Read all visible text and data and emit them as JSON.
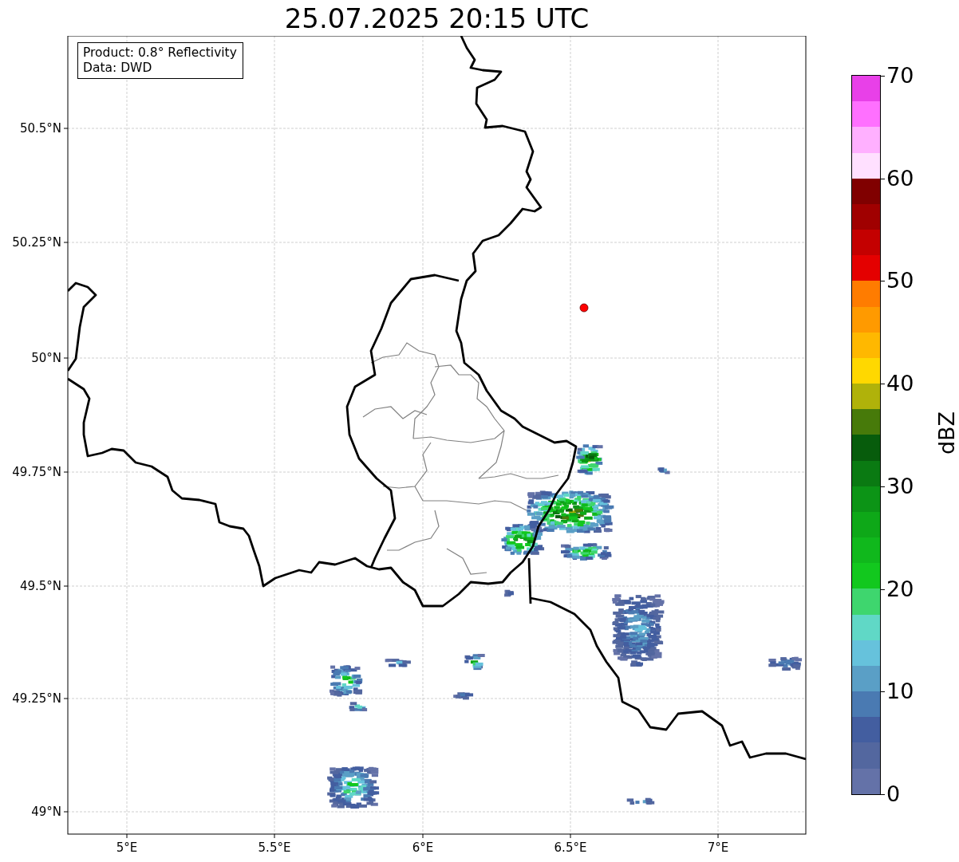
{
  "title": "25.07.2025 20:15 UTC",
  "info_box": {
    "lines": [
      "Product: 0.8° Reflectivity",
      "Data: DWD"
    ]
  },
  "map": {
    "x_ticks": [
      "5°E",
      "5.5°E",
      "6°E",
      "6.5°E",
      "7°E"
    ],
    "y_ticks": [
      "50.5°N",
      "50.25°N",
      "50°N",
      "49.75°N",
      "49.5°N",
      "49.25°N",
      "49°N"
    ]
  },
  "colorbar": {
    "label": "dBZ",
    "ticks": [
      "70",
      "60",
      "50",
      "40",
      "30",
      "20",
      "10",
      "0"
    ],
    "bins": [
      {
        "color": "#e840e8"
      },
      {
        "color": "#ff70ff"
      },
      {
        "color": "#ffb0ff"
      },
      {
        "color": "#ffe0ff"
      },
      {
        "color": "#800000"
      },
      {
        "color": "#a00000"
      },
      {
        "color": "#c40000"
      },
      {
        "color": "#e40000"
      },
      {
        "color": "#ff7c00"
      },
      {
        "color": "#ff9a00"
      },
      {
        "color": "#ffb800"
      },
      {
        "color": "#ffd800"
      },
      {
        "color": "#b0b20a"
      },
      {
        "color": "#477a0a"
      },
      {
        "color": "#075c0c"
      },
      {
        "color": "#0a7a12"
      },
      {
        "color": "#0c9416"
      },
      {
        "color": "#0ea818"
      },
      {
        "color": "#10b81c"
      },
      {
        "color": "#12c81e"
      },
      {
        "color": "#3ed66e"
      },
      {
        "color": "#60d8c6"
      },
      {
        "color": "#66c2dc"
      },
      {
        "color": "#5a9fc6"
      },
      {
        "color": "#4a7ab2"
      },
      {
        "color": "#435ea0"
      },
      {
        "color": "#53679f"
      },
      {
        "color": "#6472a8"
      }
    ]
  }
}
